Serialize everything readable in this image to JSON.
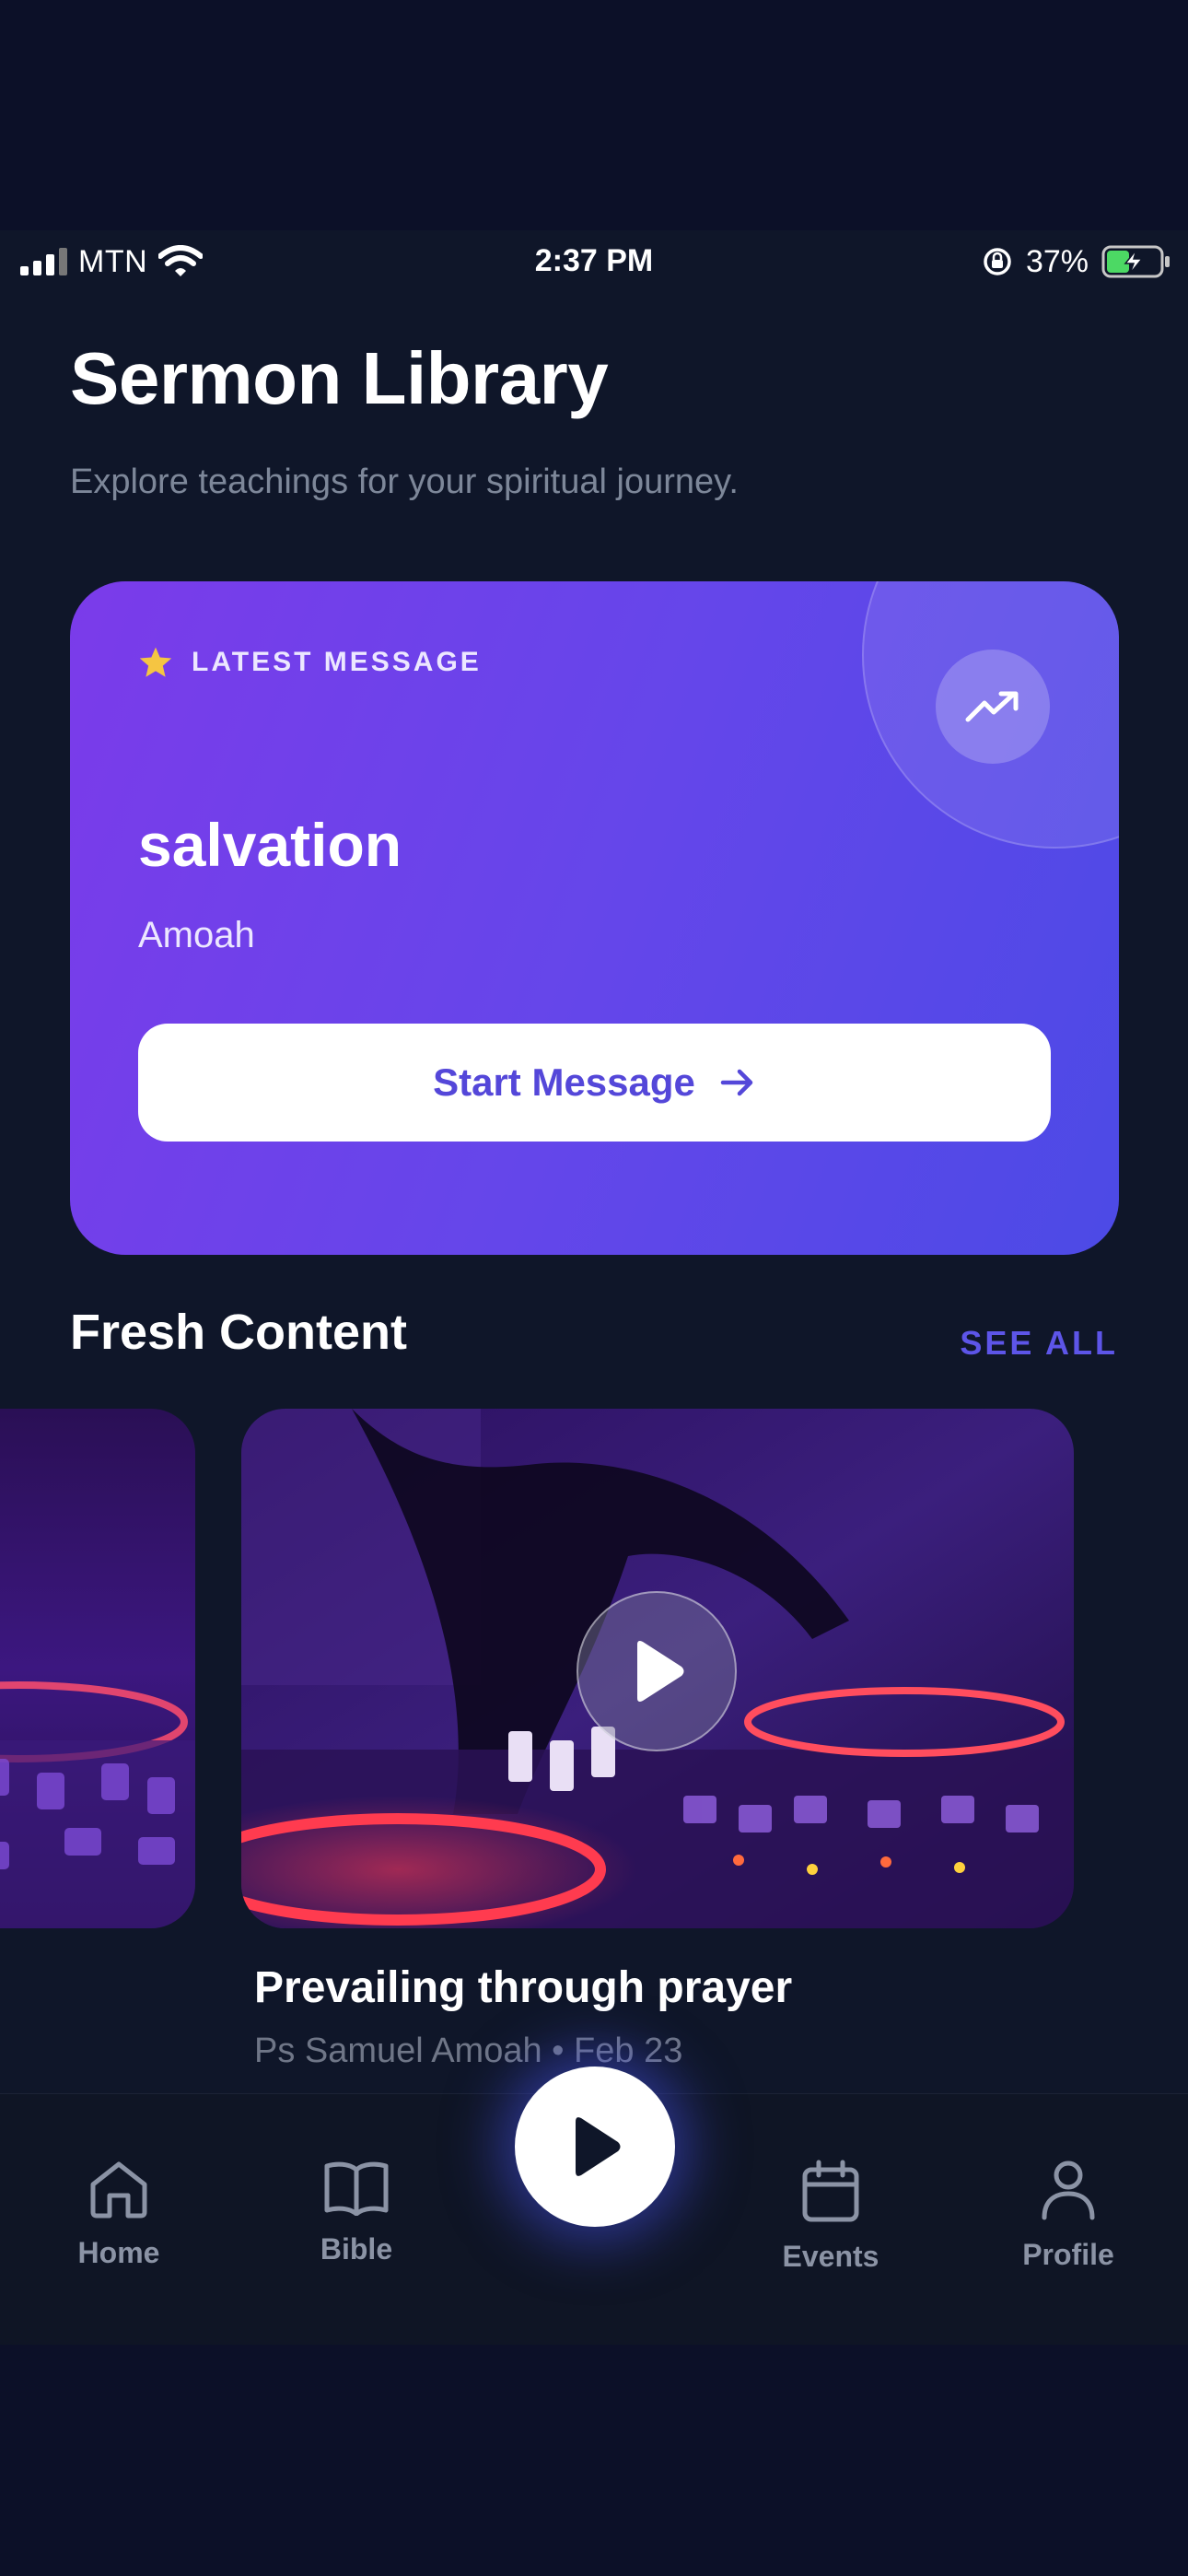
{
  "status_bar": {
    "carrier": "MTN",
    "time": "2:37 PM",
    "battery": "37%",
    "icons": [
      "cellular-signal-icon",
      "wifi-icon",
      "orientation-lock-icon",
      "battery-charging-icon"
    ]
  },
  "header": {
    "title": "Sermon Library",
    "subtitle": "Explore teachings for your spiritual journey."
  },
  "hero": {
    "label": "LATEST MESSAGE",
    "label_icon": "star-icon",
    "title": "salvation",
    "author": "Amoah",
    "cta": "Start Message",
    "cta_icon": "arrow-right-icon",
    "corner_icon": "trending-up-icon",
    "colors": {
      "gradient_start": "#7b3bea",
      "gradient_end": "#4c4ae6",
      "cta_text": "#5447d9",
      "star": "#f5c542"
    }
  },
  "fresh_content": {
    "title": "Fresh Content",
    "see_all": "SEE ALL",
    "featured": {
      "title": "Prevailing through prayer",
      "meta": "Ps Samuel Amoah • Feb 23",
      "play_icon": "play-icon"
    }
  },
  "bottom_nav": {
    "items": [
      {
        "label": "Home",
        "icon": "home-icon"
      },
      {
        "label": "Bible",
        "icon": "book-icon"
      },
      {
        "label": "Events",
        "icon": "calendar-icon"
      },
      {
        "label": "Profile",
        "icon": "user-icon"
      }
    ],
    "center_button_icon": "play-icon"
  },
  "colors": {
    "background": "#0f1629",
    "accent": "#5d55e8",
    "muted_text": "#7d8799"
  }
}
